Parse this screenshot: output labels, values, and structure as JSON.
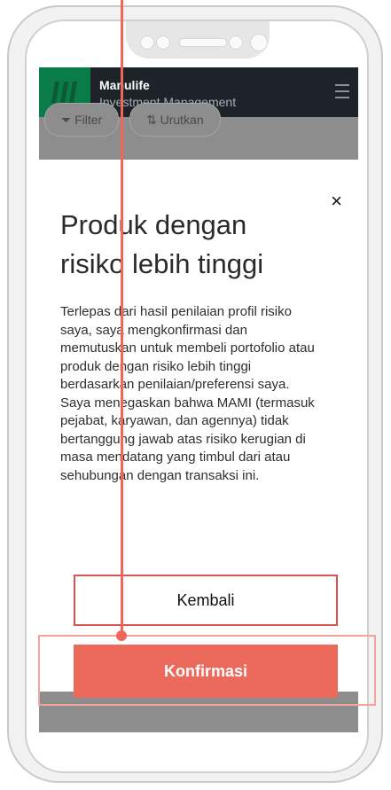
{
  "header": {
    "brand_name": "Manulife",
    "brand_sub": "Investment Management",
    "menu_icon": "hamburger-menu-icon",
    "logo_color": "#0a7c49",
    "bg_color": "#1e2229"
  },
  "toolbar": {
    "filter_label": "Filter",
    "sort_label": "Urutkan"
  },
  "modal": {
    "close_symbol": "×",
    "title": "Produk dengan risiko lebih tinggi",
    "body": "Terlepas dari hasil penilaian profil risiko saya, saya mengkonfirmasi dan memutuskan untuk membeli portofolio atau produk dengan risiko lebih tinggi berdasarkan penilaian/preferensi saya. Saya menegaskan bahwa MAMI (termasuk pejabat, karyawan, dan agennya) tidak bertanggung jawab atas risiko kerugian di masa mendatang yang timbul dari atau sehubungan dengan transaksi ini.",
    "back_label": "Kembali",
    "confirm_label": "Konfirmasi",
    "accent_color": "#ec6a5c"
  }
}
